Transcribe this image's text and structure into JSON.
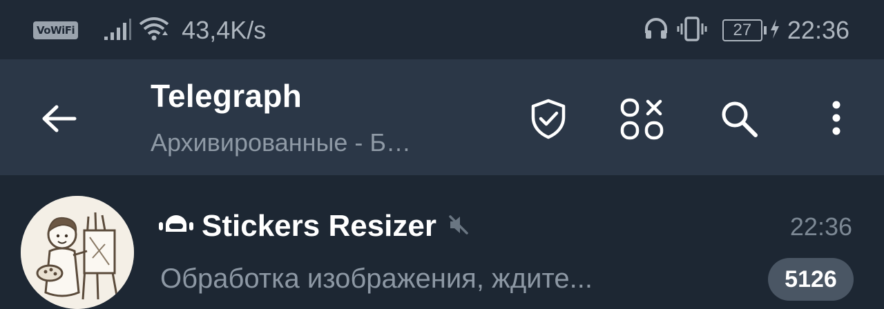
{
  "status_bar": {
    "wifi_calling_label": "VoWiFi",
    "network_speed": "43,4K/s",
    "battery_level": "27",
    "time": "22:36",
    "icons": [
      "signal-icon",
      "wifi-icon",
      "headphones-icon",
      "vibrate-icon",
      "battery-icon",
      "charging-icon"
    ]
  },
  "header": {
    "title": "Telegraph",
    "subtitle": "Архивированные - Б…",
    "icons": [
      "back-arrow-icon",
      "shield-check-icon",
      "apps-grid-icon",
      "search-icon",
      "more-vert-icon"
    ]
  },
  "chat": {
    "name": "Stickers Resizer",
    "time": "22:36",
    "preview": "Обработка изображения, ждите...",
    "unread_count": "5126",
    "icons": [
      "bot-icon",
      "muted-icon",
      "avatar"
    ]
  },
  "colors": {
    "status_bar_bg": "#1f2936",
    "header_bg": "#2b3747",
    "list_bg": "#1d2733",
    "badge_bg": "#4a5664"
  }
}
